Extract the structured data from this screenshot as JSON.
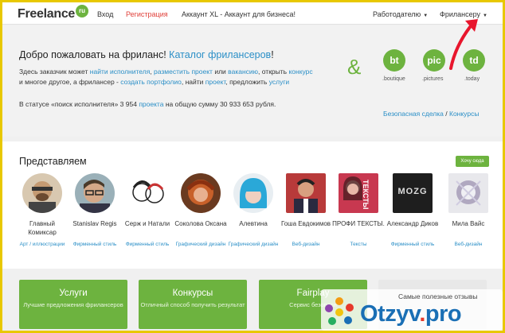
{
  "header": {
    "logo": "Freelance",
    "logo_badge": "ru",
    "login": "Вход",
    "register": "Регистрация",
    "account_xl": "Аккаунт XL - Аккаунт для бизнеса!",
    "employer_menu": "Работодателю",
    "freelancer_menu": "Фрилансеру"
  },
  "welcome": {
    "title_start": "Добро пожаловать на фриланс!",
    "title_link": "Каталог фрилансеров",
    "title_end": "!",
    "p1": "Здесь заказчик может",
    "l1": "найти исполнителя",
    "l2": "разместить проект",
    "p2": "или",
    "l3": "вакансию",
    "p3": ", открыть",
    "l4": "конкурс",
    "p4": "и многое другое, а фрилансер -",
    "l5": "создать портфолио",
    "p5": ", найти",
    "l6": "проект",
    "p6": ", предложить",
    "l7": "услуги",
    "stat_prefix": "В статусе «поиск исполнителя» 3 954",
    "stat_link": "проекта",
    "stat_suffix": "на общую сумму 30 933 653 рубля.",
    "amp": "&",
    "partners": [
      {
        "badge": "bt",
        "label": ".boutique"
      },
      {
        "badge": "pic",
        "label": ".pictures"
      },
      {
        "badge": "td",
        "label": ".today"
      }
    ],
    "safe_deal": "Безопасная сделка",
    "sep": "/",
    "contests": "Конкурсы"
  },
  "present": {
    "title": "Представляем",
    "want_button": "Хочу сюда",
    "cards": [
      {
        "name": "Главный Комиксар",
        "spec": "Арт / иллюстрации"
      },
      {
        "name": "Stanislav Regis",
        "spec": "Фирменный стиль"
      },
      {
        "name": "Серж и Натали",
        "spec": "Фирменный стиль"
      },
      {
        "name": "Соколова Оксана",
        "spec": "Графический дизайн"
      },
      {
        "name": "Алевтина",
        "spec": "Графический дизайн"
      },
      {
        "name": "Гоша Евдокимов",
        "spec": "Веб-дизайн"
      },
      {
        "name": "ПРОФИ ТЕКСТЫ.",
        "spec": "Тексты",
        "avatar_text": "ТЕКСТЫ"
      },
      {
        "name": "Александр Диков",
        "spec": "Фирменный стиль",
        "avatar_text": "MOZG"
      },
      {
        "name": "Мила Вайс",
        "spec": "Веб-дизайн"
      }
    ]
  },
  "tiles": [
    {
      "title": "Услуги",
      "sub": "Лучшие предложения фрилансеров"
    },
    {
      "title": "Конкурсы",
      "sub": "Отличный способ получить результат"
    },
    {
      "title": "Fairplay",
      "sub": "Сервис безопасн"
    }
  ],
  "watermark": {
    "tagline": "Самые полезные отзывы",
    "brand_main": "Otzyv",
    "brand_dot": ".",
    "brand_tld": "pro"
  },
  "colors": {
    "accent_green": "#6db33f",
    "link_blue": "#2b8fc7",
    "register_red": "#e0403a",
    "arrow_red": "#e8162d"
  }
}
